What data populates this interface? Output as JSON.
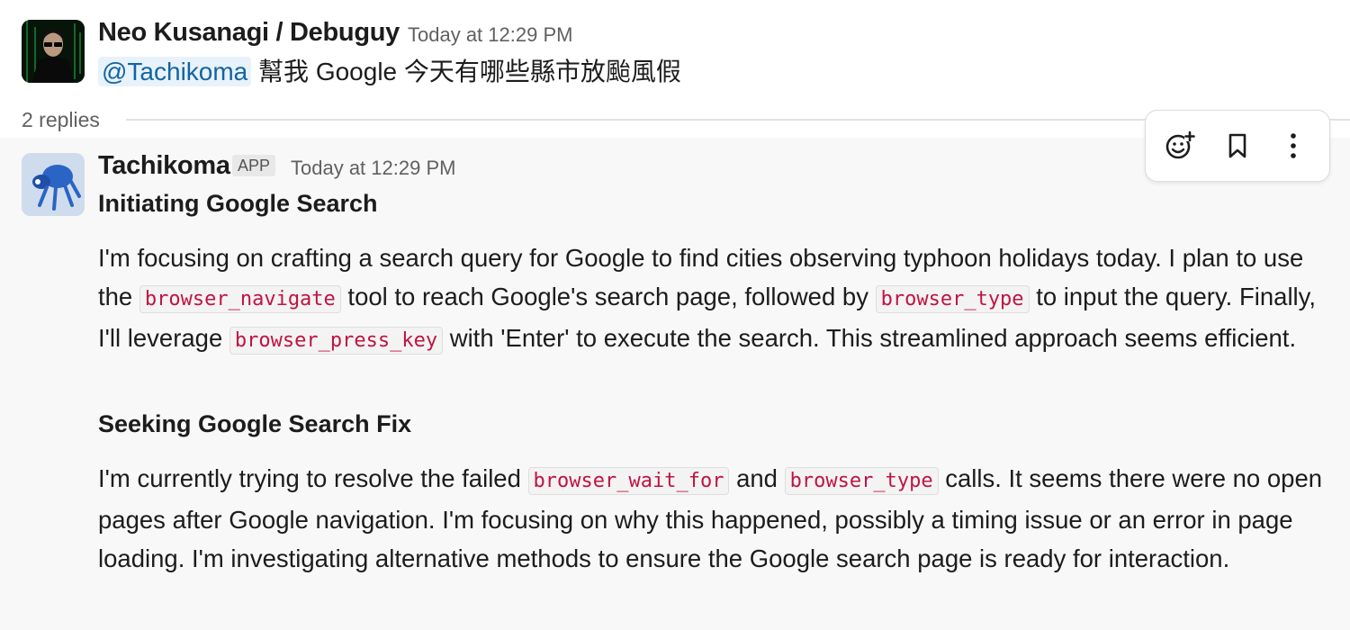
{
  "parent_message": {
    "author": "Neo Kusanagi / Debuguy",
    "timestamp": "Today at 12:29 PM",
    "mention": "@Tachikoma",
    "text": "幫我 Google 今天有哪些縣市放颱風假"
  },
  "thread": {
    "replies_label": "2 replies"
  },
  "reply_message": {
    "author": "Tachikoma",
    "badge": "APP",
    "timestamp": "Today at 12:29 PM",
    "section1_title": "Initiating Google Search",
    "section1_parts": {
      "a": "I'm focusing on crafting a search query for Google to find cities observing typhoon holidays today. I plan to use the ",
      "code1": "browser_navigate",
      "b": " tool to reach Google's search page, followed by ",
      "code2": "browser_type",
      "c": " to input the query. Finally, I'll leverage ",
      "code3": "browser_press_key",
      "d": " with 'Enter' to execute the search. This streamlined approach seems efficient."
    },
    "section2_title": "Seeking Google Search Fix",
    "section2_parts": {
      "a": "I'm currently trying to resolve the failed ",
      "code1": "browser_wait_for",
      "b": " and ",
      "code2": "browser_type",
      "c": " calls. It seems there were no open pages after Google navigation. I'm focusing on why this happened, possibly a timing issue or an error in page loading. I'm investigating alternative methods to ensure the Google search page is ready for interaction."
    }
  },
  "hover_toolbar": {
    "icons": [
      "add-reaction-icon",
      "bookmark-icon",
      "more-actions-icon"
    ]
  }
}
